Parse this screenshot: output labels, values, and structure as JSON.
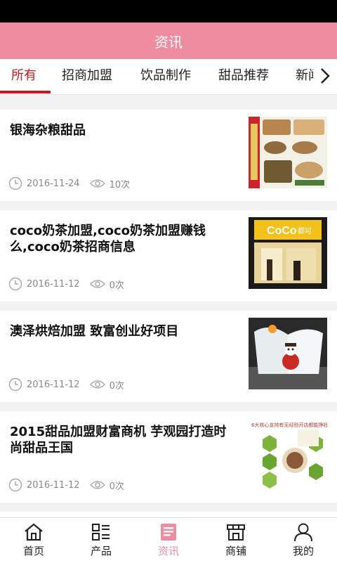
{
  "header": {
    "title": "资讯"
  },
  "tabs": [
    "所有",
    "招商加盟",
    "饮品制作",
    "甜品推荐",
    "新闻"
  ],
  "articles": [
    {
      "title": "银海杂粮甜品",
      "date": "2016-11-24",
      "views": "10次"
    },
    {
      "title": "coco奶茶加盟,coco奶茶加盟赚钱么,coco奶茶招商信息",
      "date": "2016-11-12",
      "views": "0次"
    },
    {
      "title": "澳泽烘焙加盟 致富创业好项目",
      "date": "2016-11-12",
      "views": "0次"
    },
    {
      "title": "2015甜品加盟财富商机 芋观园打造时尚甜品王国",
      "date": "2016-11-12",
      "views": "0次"
    }
  ],
  "thumb_text": {
    "coco": "CoCo",
    "coco_sub": "都可",
    "banner": "6大核心支持有无经验开店都能挣钱"
  },
  "bottom_nav": [
    "首页",
    "产品",
    "资讯",
    "商铺",
    "我的"
  ],
  "colors": {
    "header": "#f08ca0",
    "active_tab": "#c7191f",
    "active_nav": "#f08ca0"
  }
}
